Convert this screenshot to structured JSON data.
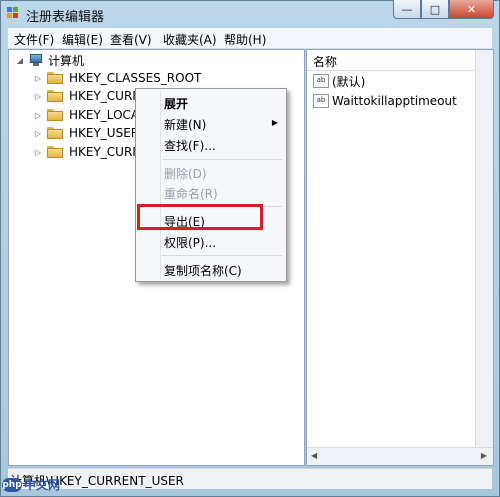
{
  "window": {
    "title": "注册表编辑器"
  },
  "caption_buttons": {
    "minimize": "—",
    "maximize": "□",
    "close": "✕"
  },
  "menubar": [
    "文件(F)",
    "编辑(E)",
    "查看(V)",
    "收藏夹(A)",
    "帮助(H)"
  ],
  "tree": {
    "root": "计算机",
    "keys": [
      "HKEY_CLASSES_ROOT",
      "HKEY_CURR",
      "HKEY_LOCA",
      "HKEY_USER",
      "HKEY_CURR"
    ]
  },
  "right_pane": {
    "column_header": "名称",
    "values": [
      {
        "icon": "ab",
        "name": "(默认)"
      },
      {
        "icon": "ab",
        "name": "Waittokillapptimeout"
      }
    ]
  },
  "context_menu": {
    "items": [
      {
        "label": "展开"
      },
      {
        "label": "新建(N)"
      },
      {
        "label": "查找(F)..."
      },
      {
        "label": "删除(D)"
      },
      {
        "label": "重命名(R)"
      },
      {
        "label": "导出(E)"
      },
      {
        "label": "权限(P)..."
      },
      {
        "label": "复制项名称(C)"
      }
    ],
    "highlight_color": "#d8201f"
  },
  "status_bar": {
    "path": "计算机\\HKEY_CURRENT_USER"
  },
  "watermark": {
    "badge": "php",
    "text": "中文网"
  }
}
